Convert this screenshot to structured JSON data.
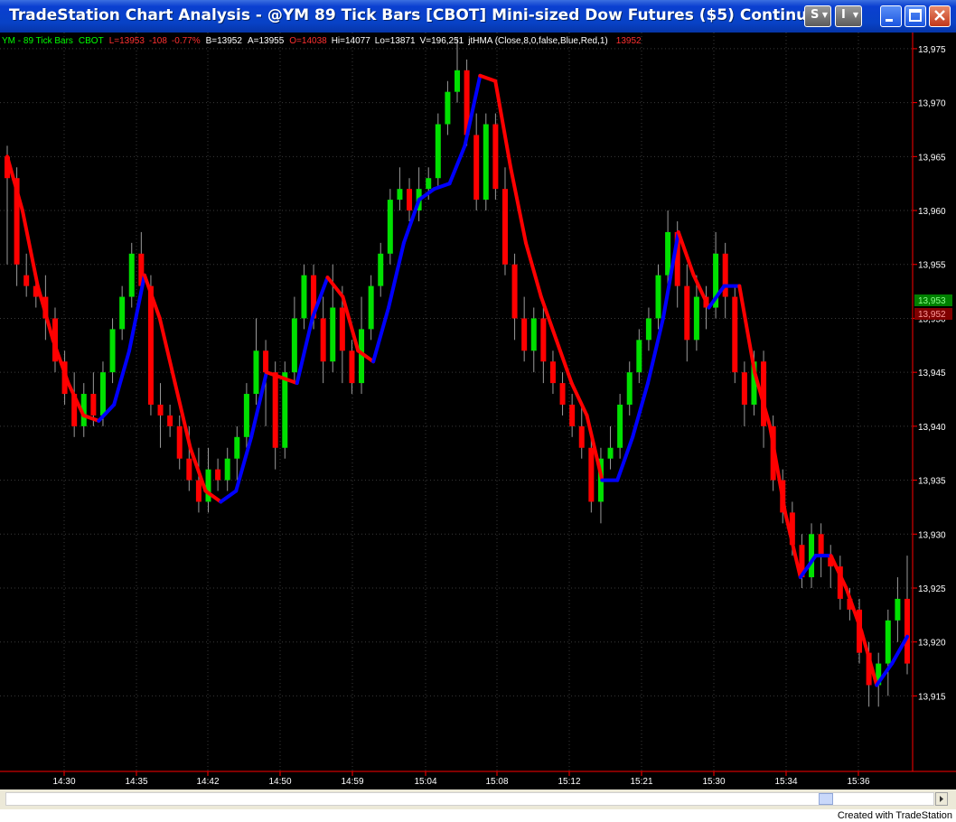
{
  "window": {
    "title": "TradeStation Chart Analysis - @YM  89 Tick Bars [CBOT] Mini-sized Dow Futures ($5) Continuo…",
    "buttons": {
      "s_menu": "S",
      "i_menu": "I"
    }
  },
  "status_bar": {
    "symbol": "YM - 89 Tick Bars",
    "exchange": "CBOT",
    "last": "L=13953",
    "change": "-108",
    "change_pct": "-0.77%",
    "bid": "B=13952",
    "ask": "A=13955",
    "open": "O=14038",
    "high": "Hi=14077",
    "low": "Lo=13871",
    "volume": "V=196,251",
    "indicator": "jtHMA (Close,8,0,false,Blue,Red,1)",
    "indicator_value": "13952"
  },
  "price_markers": {
    "last": "13,953",
    "indicator": "13,952"
  },
  "footer": {
    "credit": "Created with TradeStation"
  },
  "colors": {
    "up": "#00e000",
    "down": "#ff0000",
    "hma_up": "#0000ff",
    "hma_down": "#ff0000",
    "background": "#000000"
  },
  "chart_data": {
    "type": "candlestick",
    "y_ticks": [
      13915,
      13920,
      13925,
      13930,
      13935,
      13940,
      13945,
      13950,
      13955,
      13960,
      13965,
      13970,
      13975
    ],
    "y_tick_labels": [
      "13,915",
      "13,920",
      "13,925",
      "13,930",
      "13,935",
      "13,940",
      "13,945",
      "13,950",
      "13,955",
      "13,960",
      "13,965",
      "13,970",
      "13,975"
    ],
    "ylim": [
      13908,
      13976.5
    ],
    "x_labels": [
      "14:30",
      "14:35",
      "14:42",
      "14:50",
      "14:59",
      "15:04",
      "15:08",
      "15:12",
      "15:21",
      "15:30",
      "15:34",
      "15:36"
    ],
    "hma_path": [
      13965,
      13960,
      13953,
      13948,
      13944,
      13941,
      13940.5,
      13942,
      13947,
      13954,
      13950,
      13944,
      13938,
      13934,
      13933,
      13934,
      13939,
      13945,
      13944.5,
      13944,
      13950,
      13953.8,
      13952,
      13947,
      13946,
      13951,
      13957,
      13961,
      13962,
      13962.5,
      13966,
      13972.5,
      13972,
      13964,
      13957,
      13952,
      13948,
      13944,
      13941,
      13935,
      13935,
      13939,
      13944,
      13950,
      13958,
      13954,
      13951,
      13953,
      13953,
      13945,
      13940,
      13932,
      13926,
      13928,
      13928,
      13925,
      13921,
      13916,
      13918,
      13920.5
    ],
    "candles": [
      [
        13965,
        13963,
        13966,
        13955
      ],
      [
        13963,
        13955,
        13964,
        13953
      ],
      [
        13954,
        13953,
        13956,
        13952
      ],
      [
        13953,
        13952,
        13954,
        13951
      ],
      [
        13952,
        13950,
        13954,
        13948
      ],
      [
        13950,
        13946,
        13951,
        13945
      ],
      [
        13946,
        13943,
        13947,
        13942
      ],
      [
        13943,
        13940,
        13945,
        13939
      ],
      [
        13940,
        13943,
        13944,
        13939
      ],
      [
        13943,
        13941,
        13945,
        13940
      ],
      [
        13941,
        13945,
        13946,
        13940
      ],
      [
        13945,
        13949,
        13950,
        13944
      ],
      [
        13949,
        13952,
        13953,
        13948
      ],
      [
        13952,
        13956,
        13957,
        13951
      ],
      [
        13956,
        13953,
        13958,
        13952
      ],
      [
        13953,
        13942,
        13954,
        13941
      ],
      [
        13942,
        13941,
        13944,
        13938
      ],
      [
        13941,
        13940,
        13942,
        13939
      ],
      [
        13940,
        13937,
        13941,
        13936
      ],
      [
        13937,
        13935,
        13940,
        13934
      ],
      [
        13935,
        13933,
        13938,
        13932
      ],
      [
        13933,
        13936,
        13938,
        13932
      ],
      [
        13936,
        13935,
        13937,
        13934
      ],
      [
        13935,
        13937,
        13938,
        13934
      ],
      [
        13937,
        13939,
        13940,
        13935
      ],
      [
        13939,
        13943,
        13944,
        13938
      ],
      [
        13943,
        13947,
        13950,
        13942
      ],
      [
        13947,
        13945,
        13948,
        13940
      ],
      [
        13945,
        13938,
        13946,
        13936
      ],
      [
        13938,
        13945,
        13946,
        13937
      ],
      [
        13945,
        13950,
        13952,
        13944
      ],
      [
        13950,
        13954,
        13955,
        13949
      ],
      [
        13954,
        13950,
        13955,
        13949
      ],
      [
        13950,
        13946,
        13952,
        13944
      ],
      [
        13946,
        13951,
        13955,
        13945
      ],
      [
        13951,
        13947,
        13953,
        13944
      ],
      [
        13947,
        13944,
        13948,
        13943
      ],
      [
        13944,
        13949,
        13952,
        13943
      ],
      [
        13949,
        13953,
        13954,
        13948
      ],
      [
        13953,
        13956,
        13957,
        13952
      ],
      [
        13956,
        13961,
        13962,
        13955
      ],
      [
        13961,
        13962,
        13964,
        13960
      ],
      [
        13962,
        13960,
        13963,
        13959
      ],
      [
        13960,
        13962,
        13964,
        13959
      ],
      [
        13962,
        13963,
        13964,
        13961
      ],
      [
        13963,
        13968,
        13969,
        13962
      ],
      [
        13968,
        13971,
        13972,
        13967
      ],
      [
        13971,
        13973,
        13976,
        13970
      ],
      [
        13973,
        13967,
        13974,
        13966
      ],
      [
        13967,
        13961,
        13969,
        13960
      ],
      [
        13961,
        13968,
        13969,
        13960
      ],
      [
        13968,
        13962,
        13969,
        13961
      ],
      [
        13962,
        13955,
        13964,
        13954
      ],
      [
        13955,
        13950,
        13956,
        13948
      ],
      [
        13950,
        13947,
        13952,
        13946
      ],
      [
        13947,
        13950,
        13951,
        13945
      ],
      [
        13950,
        13946,
        13951,
        13944
      ],
      [
        13946,
        13944,
        13947,
        13943
      ],
      [
        13944,
        13942,
        13945,
        13941
      ],
      [
        13942,
        13940,
        13943,
        13939
      ],
      [
        13940,
        13938,
        13942,
        13937
      ],
      [
        13938,
        13933,
        13939,
        13932
      ],
      [
        13933,
        13937,
        13938,
        13931
      ],
      [
        13937,
        13938,
        13940,
        13936
      ],
      [
        13938,
        13942,
        13943,
        13937
      ],
      [
        13942,
        13945,
        13946,
        13941
      ],
      [
        13945,
        13948,
        13949,
        13944
      ],
      [
        13948,
        13950,
        13951,
        13947
      ],
      [
        13950,
        13954,
        13955,
        13949
      ],
      [
        13954,
        13958,
        13960,
        13953
      ],
      [
        13958,
        13953,
        13959,
        13951
      ],
      [
        13953,
        13948,
        13955,
        13946
      ],
      [
        13948,
        13952,
        13954,
        13947
      ],
      [
        13952,
        13951,
        13953,
        13949
      ],
      [
        13951,
        13956,
        13958,
        13950
      ],
      [
        13956,
        13952,
        13957,
        13950
      ],
      [
        13952,
        13945,
        13953,
        13944
      ],
      [
        13945,
        13942,
        13946,
        13940
      ],
      [
        13942,
        13946,
        13947,
        13941
      ],
      [
        13946,
        13940,
        13947,
        13938
      ],
      [
        13940,
        13935,
        13941,
        13934
      ],
      [
        13935,
        13932,
        13936,
        13931
      ],
      [
        13932,
        13929,
        13933,
        13928
      ],
      [
        13929,
        13926,
        13930,
        13925
      ],
      [
        13926,
        13930,
        13931,
        13925
      ],
      [
        13930,
        13928,
        13931,
        13926
      ],
      [
        13928,
        13927,
        13929,
        13925
      ],
      [
        13927,
        13924,
        13928,
        13923
      ],
      [
        13924,
        13923,
        13925,
        13922
      ],
      [
        13923,
        13919,
        13924,
        13918
      ],
      [
        13919,
        13916,
        13920,
        13914
      ],
      [
        13916,
        13918,
        13919,
        13914
      ],
      [
        13918,
        13922,
        13923,
        13915
      ],
      [
        13922,
        13924,
        13926,
        13920
      ],
      [
        13924,
        13918,
        13928,
        13917
      ]
    ]
  }
}
